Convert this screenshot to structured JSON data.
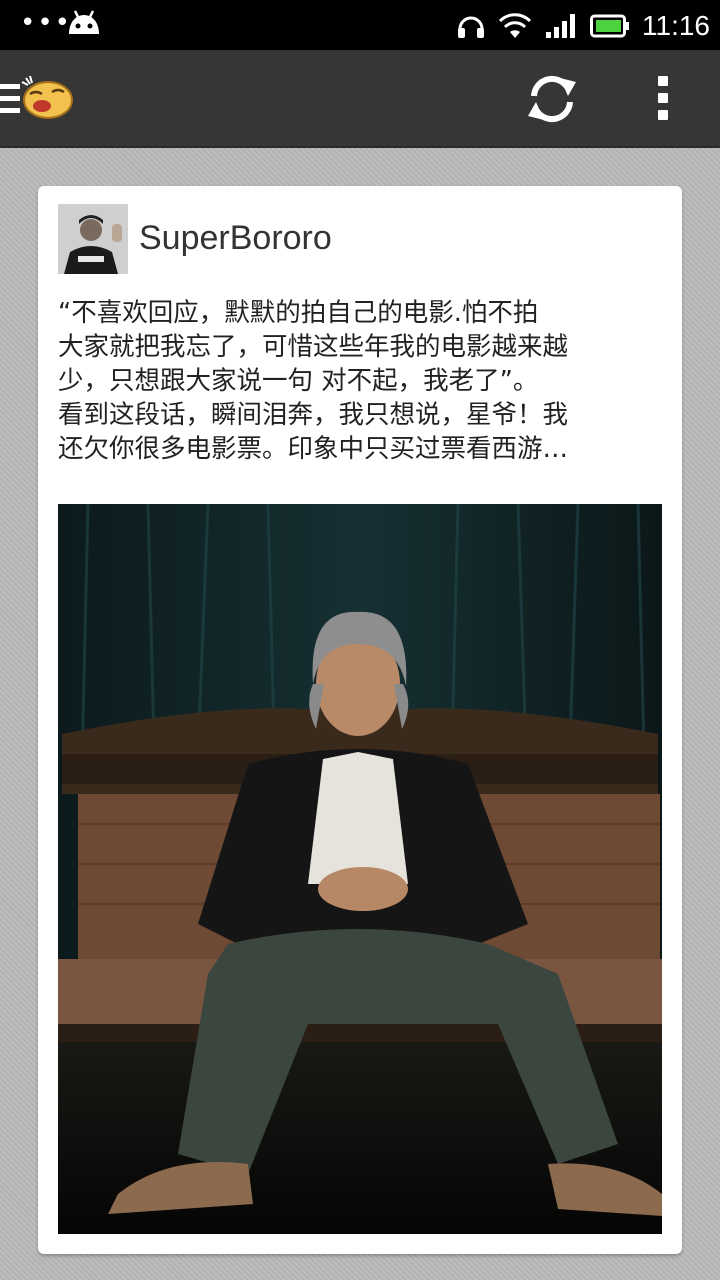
{
  "status_bar": {
    "time": "11:16",
    "icons": [
      "notification-dots-icon",
      "android-icon",
      "headset-icon",
      "wifi-icon",
      "signal-icon",
      "battery-icon"
    ]
  },
  "action_bar": {
    "icons": [
      "drawer-menu-icon",
      "app-mascot-icon",
      "refresh-icon",
      "overflow-menu-icon"
    ]
  },
  "post": {
    "author": "SuperBororo",
    "text_lines": [
      "“不喜欢回应，默默的拍自己的电影.怕不拍",
      "大家就把我忘了，可惜这些年我的电影越来越",
      "少，只想跟大家说一句 对不起，我老了”。",
      "看到这段话，瞬间泪奔，我只想说，星爷！我",
      "还欠你很多电影票。印象中只买过票看西游…"
    ]
  },
  "colors": {
    "status_bar_bg": "#000000",
    "action_bar_bg": "#363636",
    "page_bg": "#b9b9b9",
    "card_bg": "#ffffff",
    "text": "#222222"
  }
}
